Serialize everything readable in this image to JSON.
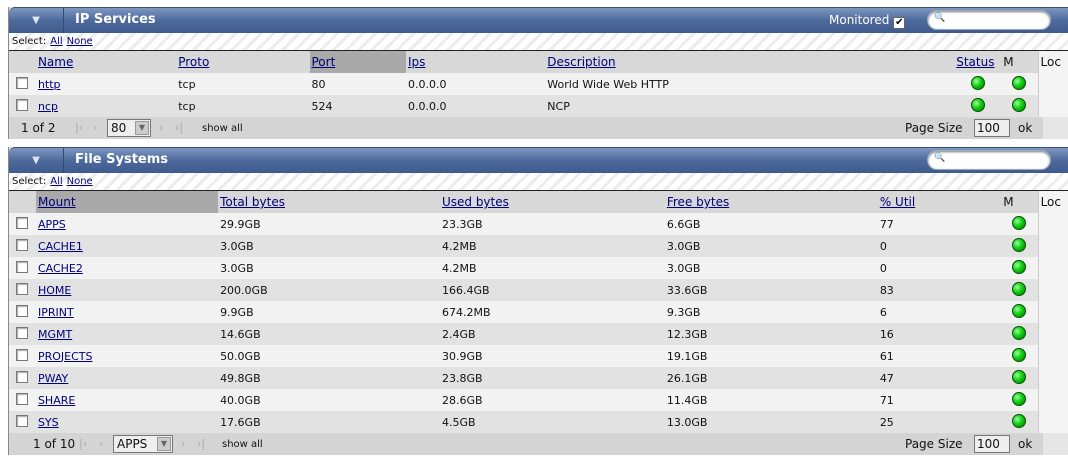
{
  "ip_services": {
    "title": "IP Services",
    "monitored_label": "Monitored",
    "monitored_checked": true,
    "search_placeholder": "",
    "select_label": "Select:",
    "select_all": "All",
    "select_none": "None",
    "columns": [
      "Name",
      "Proto",
      "Port",
      "Ips",
      "Description",
      "Status",
      "M",
      "Loc"
    ],
    "sorted_column": "Port",
    "rows": [
      {
        "name": "http",
        "proto": "tcp",
        "port": "80",
        "ips": "0.0.0.0",
        "description": "World Wide Web HTTP",
        "status": "green",
        "m": "green"
      },
      {
        "name": "ncp",
        "proto": "tcp",
        "port": "524",
        "ips": "0.0.0.0",
        "description": "NCP",
        "status": "green",
        "m": "green"
      }
    ],
    "footer": {
      "page_info": "1 of 2",
      "page_select": "80",
      "show_all": "show all",
      "page_size_label": "Page Size",
      "page_size": "100",
      "ok": "ok"
    }
  },
  "file_systems": {
    "title": "File Systems",
    "search_placeholder": "",
    "select_label": "Select:",
    "select_all": "All",
    "select_none": "None",
    "columns": [
      "Mount",
      "Total bytes",
      "Used bytes",
      "Free bytes",
      "% Util",
      "M",
      "Loc"
    ],
    "sorted_column": "Mount",
    "rows": [
      {
        "mount": "APPS",
        "total": "29.9GB",
        "used": "23.3GB",
        "free": "6.6GB",
        "util": "77",
        "m": "green"
      },
      {
        "mount": "CACHE1",
        "total": "3.0GB",
        "used": "4.2MB",
        "free": "3.0GB",
        "util": "0",
        "m": "green"
      },
      {
        "mount": "CACHE2",
        "total": "3.0GB",
        "used": "4.2MB",
        "free": "3.0GB",
        "util": "0",
        "m": "green"
      },
      {
        "mount": "HOME",
        "total": "200.0GB",
        "used": "166.4GB",
        "free": "33.6GB",
        "util": "83",
        "m": "green"
      },
      {
        "mount": "IPRINT",
        "total": "9.9GB",
        "used": "674.2MB",
        "free": "9.3GB",
        "util": "6",
        "m": "green"
      },
      {
        "mount": "MGMT",
        "total": "14.6GB",
        "used": "2.4GB",
        "free": "12.3GB",
        "util": "16",
        "m": "green"
      },
      {
        "mount": "PROJECTS",
        "total": "50.0GB",
        "used": "30.9GB",
        "free": "19.1GB",
        "util": "61",
        "m": "green"
      },
      {
        "mount": "PWAY",
        "total": "49.8GB",
        "used": "23.8GB",
        "free": "26.1GB",
        "util": "47",
        "m": "green"
      },
      {
        "mount": "SHARE",
        "total": "40.0GB",
        "used": "28.6GB",
        "free": "11.4GB",
        "util": "71",
        "m": "green"
      },
      {
        "mount": "SYS",
        "total": "17.6GB",
        "used": "4.5GB",
        "free": "13.0GB",
        "util": "25",
        "m": "green"
      }
    ],
    "footer": {
      "page_info": "1 of 10",
      "page_select": "APPS",
      "show_all": "show all",
      "page_size_label": "Page Size",
      "page_size": "100",
      "ok": "ok"
    }
  }
}
